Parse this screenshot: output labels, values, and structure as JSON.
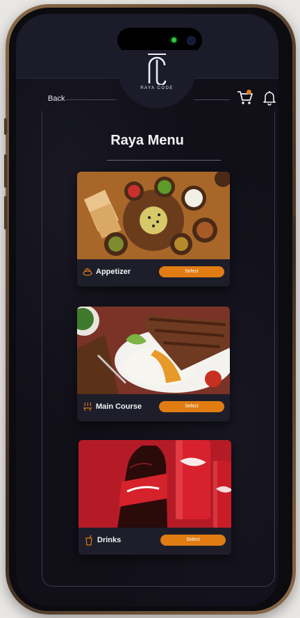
{
  "header": {
    "logo_text": "RAYA CODE",
    "back_label": "Back"
  },
  "page": {
    "title": "Raya Menu"
  },
  "categories": [
    {
      "label": "Appetizer",
      "icon": "dish-icon",
      "select_label": "Select"
    },
    {
      "label": "Main Course",
      "icon": "grill-icon",
      "select_label": "Select"
    },
    {
      "label": "Drinks",
      "icon": "drink-cup-icon",
      "select_label": "Select"
    }
  ],
  "colors": {
    "accent": "#e07c12",
    "background": "#111019",
    "card": "#1d1e2a"
  }
}
